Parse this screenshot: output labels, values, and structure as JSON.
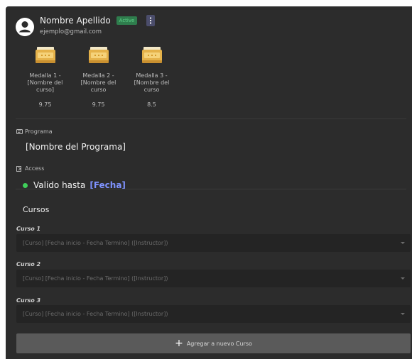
{
  "user": {
    "name": "Nombre Apellido",
    "status_badge": "Active",
    "email": "ejemplo@gmail.com"
  },
  "medals": [
    {
      "label": "Medalla 1 - [Nombre del curso]",
      "score": "9.75"
    },
    {
      "label": "Medalla 2 - [Nombre del curso",
      "score": "9.75"
    },
    {
      "label": "Medalla 3 - [Nombre del curso",
      "score": "8.5"
    }
  ],
  "program": {
    "label": "Programa",
    "value": "[Nombre del Programa]"
  },
  "access": {
    "label": "Access",
    "status_text": "Valido hasta",
    "date": "[Fecha]"
  },
  "courses": {
    "title": "Cursos",
    "items": [
      {
        "label": "Curso 1",
        "placeholder": "[Curso] [Fecha inicio - Fecha Termino] ([Instructor])"
      },
      {
        "label": "Curso 2",
        "placeholder": "[Curso] [Fecha inicio - Fecha Termino] ([Instructor])"
      },
      {
        "label": "Curso 3",
        "placeholder": "[Curso] [Fecha inicio - Fecha Termino] ([Instructor])"
      }
    ],
    "add_button": "Agregar a nuevo Curso"
  },
  "colors": {
    "panel_bg": "#2c2c2c",
    "badge_green": "#2f7d4d",
    "accent_blue": "#7f93ff",
    "status_dot": "#3fcf5a",
    "medal_gold": "#e5b24a"
  },
  "icons": [
    "user-avatar-icon",
    "kebab-menu-icon",
    "medal-icon",
    "id-card-icon",
    "door-icon",
    "chevron-down-icon",
    "plus-icon"
  ]
}
